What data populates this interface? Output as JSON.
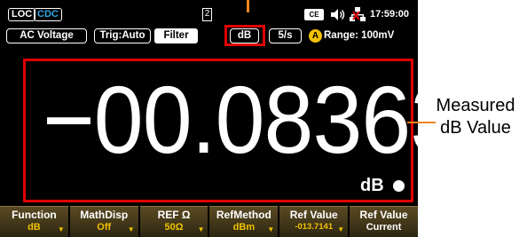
{
  "status_bar": {
    "loc": "LOC",
    "cdc": "CDC",
    "page": "2",
    "ce_icon": "CE",
    "speaker_icon": "speaker-icon",
    "lan_icon": "lan-disconnected-icon",
    "time": "17:59:00"
  },
  "mode_bar": {
    "function": "AC Voltage",
    "trigger": "Trig:Auto",
    "filter": "Filter",
    "unit": "dB",
    "rate": "5/s",
    "auto_badge": "A",
    "range": "Range: 100mV"
  },
  "reading": {
    "value": "−00.08363",
    "unit": "dB"
  },
  "softkeys": [
    {
      "label": "Function",
      "value": "dB"
    },
    {
      "label": "MathDisp",
      "value": "Off"
    },
    {
      "label": "REF Ω",
      "value": "50Ω"
    },
    {
      "label": "RefMethod",
      "value": "dBm"
    },
    {
      "label": "Ref Value",
      "value": "-013.7141"
    },
    {
      "label": "Ref Value",
      "value": "Current"
    }
  ],
  "annotation": {
    "line1": "Measured",
    "line2": "dB Value"
  },
  "colors": {
    "highlight": "#e00000",
    "callout": "#f0851e",
    "softkey_value": "#f2c200",
    "cdc": "#2fa7e4"
  }
}
